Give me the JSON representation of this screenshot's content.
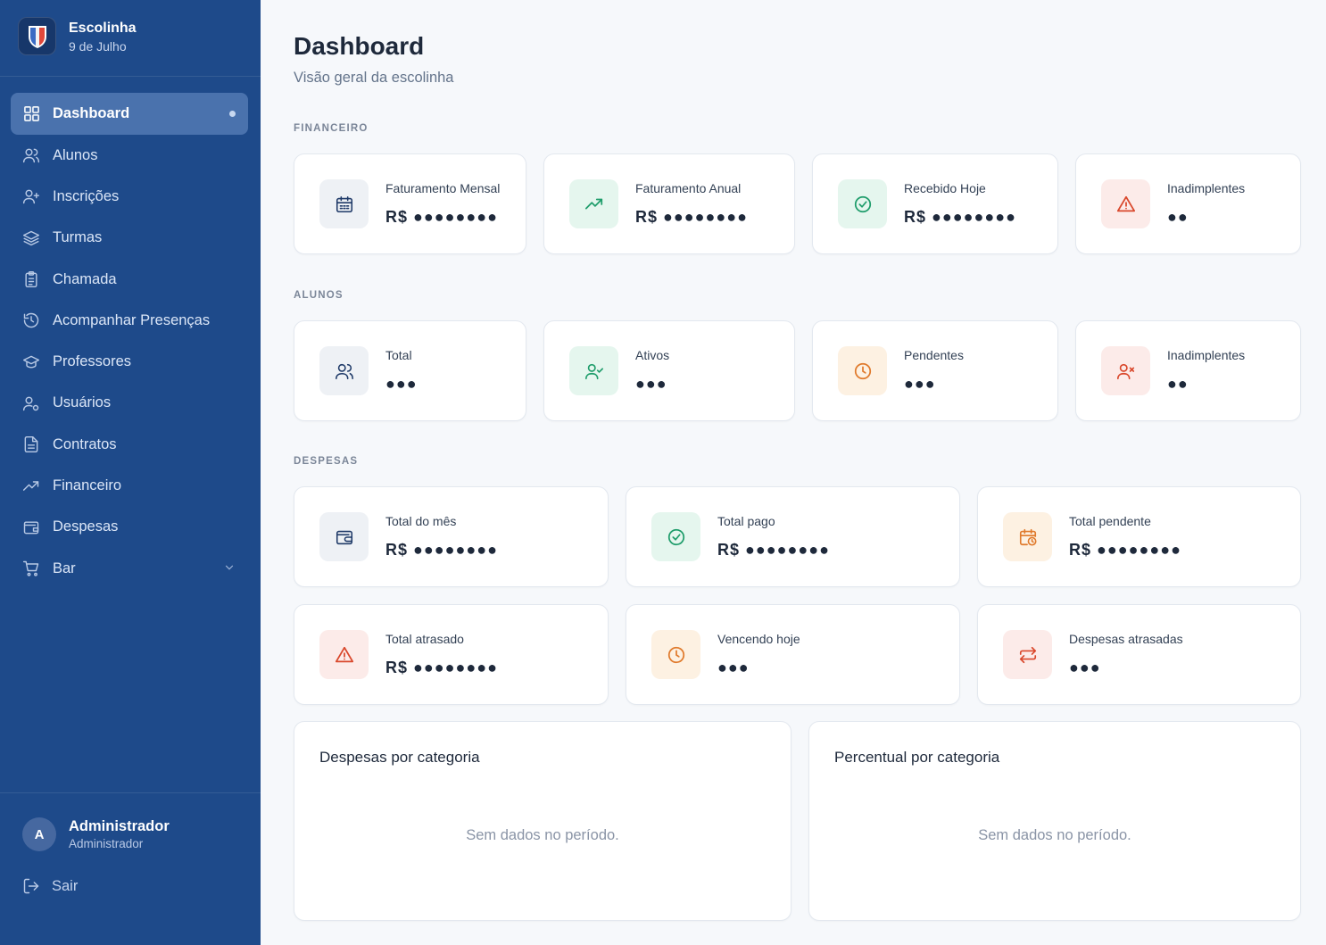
{
  "brand": {
    "title": "Escolinha",
    "subtitle": "9 de Julho"
  },
  "nav": [
    {
      "label": "Dashboard",
      "icon": "grid-icon",
      "active": true
    },
    {
      "label": "Alunos",
      "icon": "users-icon"
    },
    {
      "label": "Inscrições",
      "icon": "user-plus-icon"
    },
    {
      "label": "Turmas",
      "icon": "layers-icon"
    },
    {
      "label": "Chamada",
      "icon": "clipboard-icon"
    },
    {
      "label": "Acompanhar Presenças",
      "icon": "history-icon"
    },
    {
      "label": "Professores",
      "icon": "graduation-cap-icon"
    },
    {
      "label": "Usuários",
      "icon": "user-cog-icon"
    },
    {
      "label": "Contratos",
      "icon": "file-text-icon"
    },
    {
      "label": "Financeiro",
      "icon": "trending-up-icon"
    },
    {
      "label": "Despesas",
      "icon": "wallet-icon"
    },
    {
      "label": "Bar",
      "icon": "cart-icon",
      "expandable": true
    }
  ],
  "user": {
    "initial": "A",
    "name": "Administrador",
    "role": "Administrador"
  },
  "logout_label": "Sair",
  "page": {
    "title": "Dashboard",
    "subtitle": "Visão geral da escolinha"
  },
  "sections": {
    "financeiro": "FINANCEIRO",
    "alunos": "ALUNOS",
    "despesas": "DESPESAS"
  },
  "financeiro_cards": [
    {
      "label": "Faturamento Mensal",
      "value": "R$ ●●●●●●●●",
      "icon": "calendar-icon"
    },
    {
      "label": "Faturamento Anual",
      "value": "R$ ●●●●●●●●",
      "icon": "trending-up-icon"
    },
    {
      "label": "Recebido Hoje",
      "value": "R$ ●●●●●●●●",
      "icon": "check-circle-icon"
    },
    {
      "label": "Inadimplentes",
      "value": "●●",
      "icon": "alert-triangle-icon"
    }
  ],
  "alunos_cards": [
    {
      "label": "Total",
      "value": "●●●",
      "icon": "users-icon"
    },
    {
      "label": "Ativos",
      "value": "●●●",
      "icon": "user-check-icon"
    },
    {
      "label": "Pendentes",
      "value": "●●●",
      "icon": "clock-icon"
    },
    {
      "label": "Inadimplentes",
      "value": "●●",
      "icon": "user-x-icon"
    }
  ],
  "despesas_cards": [
    {
      "label": "Total do mês",
      "value": "R$ ●●●●●●●●",
      "icon": "wallet-icon"
    },
    {
      "label": "Total pago",
      "value": "R$ ●●●●●●●●",
      "icon": "check-circle-icon"
    },
    {
      "label": "Total pendente",
      "value": "R$ ●●●●●●●●",
      "icon": "calendar-clock-icon"
    },
    {
      "label": "Total atrasado",
      "value": "R$ ●●●●●●●●",
      "icon": "alert-triangle-icon"
    },
    {
      "label": "Vencendo hoje",
      "value": "●●●",
      "icon": "clock-icon"
    },
    {
      "label": "Despesas atrasadas",
      "value": "●●●",
      "icon": "repeat-icon"
    }
  ],
  "charts": [
    {
      "title": "Despesas por categoria",
      "empty": "Sem dados no período."
    },
    {
      "title": "Percentual por categoria",
      "empty": "Sem dados no período."
    }
  ],
  "colors": {
    "sidebar": "#1e4a8a",
    "active_item": "#4a72ad",
    "slate_icon": "#1f3a68",
    "green_icon": "#1f9d6b",
    "red_icon": "#d9472b",
    "amber_icon": "#e07a2c"
  }
}
